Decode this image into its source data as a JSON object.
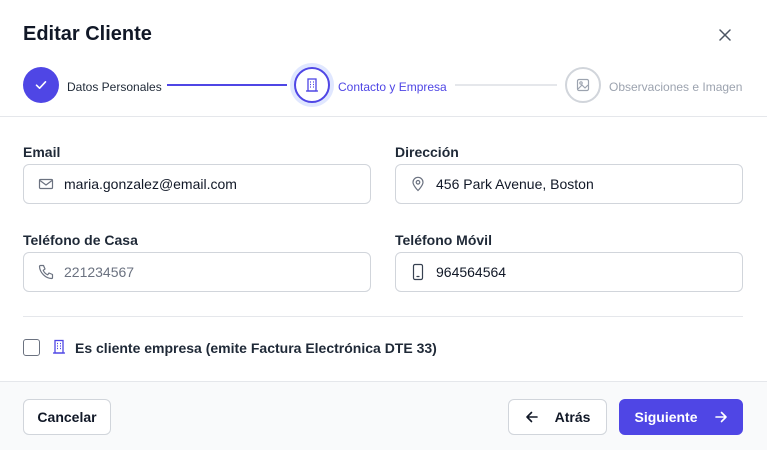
{
  "dialog": {
    "title": "Editar Cliente"
  },
  "stepper": {
    "steps": [
      {
        "label": "Datos Personales",
        "state": "completed",
        "icon": "check-icon"
      },
      {
        "label": "Contacto y Empresa",
        "state": "active",
        "icon": "building-icon"
      },
      {
        "label": "Observaciones e Imagen",
        "state": "pending",
        "icon": "image-icon"
      }
    ]
  },
  "form": {
    "email": {
      "label": "Email",
      "value": "maria.gonzalez@email.com",
      "placeholder": "",
      "icon": "mail-icon"
    },
    "address": {
      "label": "Dirección",
      "value": "456 Park Avenue, Boston",
      "placeholder": "",
      "icon": "map-pin-icon"
    },
    "home_phone": {
      "label": "Teléfono de Casa",
      "value": "",
      "placeholder": "221234567",
      "icon": "phone-icon"
    },
    "mobile_phone": {
      "label": "Teléfono Móvil",
      "value": "964564564",
      "placeholder": "",
      "icon": "smartphone-icon"
    },
    "company_checkbox": {
      "label": "Es cliente empresa (emite Factura Electrónica DTE 33)",
      "checked": false,
      "icon": "building-icon"
    }
  },
  "footer": {
    "cancel_label": "Cancelar",
    "back_label": "Atrás",
    "next_label": "Siguiente"
  },
  "colors": {
    "accent": "#4f46e5",
    "accent_light": "#e0e7ff",
    "pending": "#d1d5db",
    "pending_text": "#9ca3af"
  }
}
